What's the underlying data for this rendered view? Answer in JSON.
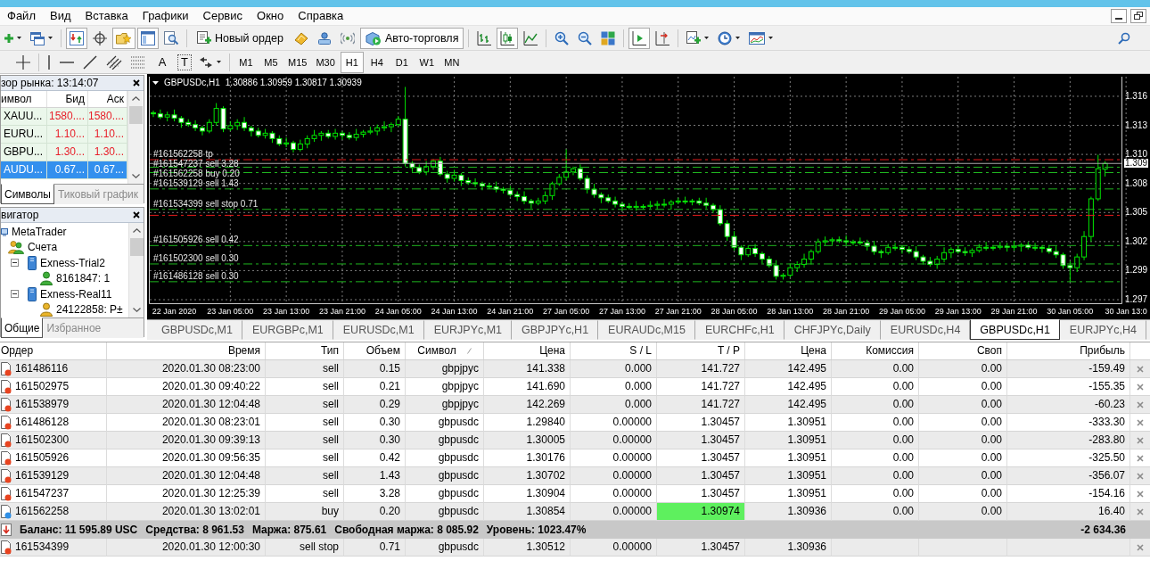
{
  "menu": {
    "items": [
      "Файл",
      "Вид",
      "Вставка",
      "Графики",
      "Сервис",
      "Окно",
      "Справка"
    ]
  },
  "toolbar": {
    "new_order": "Новый ордер",
    "autotrading": {
      "label": "Авто-торговля",
      "pressed": true
    },
    "pressed": {
      "market_watch": true,
      "data_window": false,
      "navigator": true,
      "terminal": true,
      "tester": false,
      "bar_chart": false,
      "candle_chart": true,
      "line_chart": false,
      "autoscroll": true,
      "chart_shift": false
    }
  },
  "drawing_toolbar": {
    "text_tool": "A",
    "label_tool": "T",
    "timeframes": [
      {
        "label": "M1",
        "selected": false
      },
      {
        "label": "M5",
        "selected": false
      },
      {
        "label": "M15",
        "selected": false
      },
      {
        "label": "M30",
        "selected": false
      },
      {
        "label": "H1",
        "selected": true
      },
      {
        "label": "H4",
        "selected": false
      },
      {
        "label": "D1",
        "selected": false
      },
      {
        "label": "W1",
        "selected": false
      },
      {
        "label": "MN",
        "selected": false
      }
    ]
  },
  "market_watch": {
    "title": "зор рынка: 13:14:07",
    "columns": [
      "имвол",
      "Бид",
      "Аск"
    ],
    "rows": [
      {
        "symbol": "XAUU...",
        "bid": "1580....",
        "ask": "1580....",
        "falling": true,
        "selected": false
      },
      {
        "symbol": "EURU...",
        "bid": "1.10...",
        "ask": "1.10...",
        "falling": true,
        "selected": false
      },
      {
        "symbol": "GBPU...",
        "bid": "1.30...",
        "ask": "1.30...",
        "falling": true,
        "selected": false
      },
      {
        "symbol": "AUDU...",
        "bid": "0.67...",
        "ask": "0.67...",
        "selected": true
      }
    ],
    "tabs": [
      {
        "label": "Символы",
        "selected": true
      },
      {
        "label": "Тиковый график",
        "selected": false
      }
    ]
  },
  "navigator": {
    "title": "вигатор",
    "tree": [
      {
        "label": "MetaTrader",
        "kind": "terminal",
        "children": [
          {
            "label": "Счета",
            "kind": "accounts",
            "children": [
              {
                "label": "Exness-Trial2",
                "kind": "server",
                "expanded": true,
                "children": [
                  {
                    "label": "8161847: 1",
                    "kind": "demo"
                  }
                ]
              },
              {
                "label": "Exness-Real11",
                "kind": "server",
                "expanded": true,
                "children": [
                  {
                    "label": "24122858: P±",
                    "kind": "real"
                  }
                ]
              }
            ]
          }
        ]
      }
    ],
    "tabs": [
      {
        "label": "Общие",
        "selected": true
      },
      {
        "label": "Избранное",
        "selected": false
      }
    ]
  },
  "chart": {
    "ohlc_readout": "1.30886 1.30959 1.30817 1.30939",
    "chart_data": {
      "type": "candlestick",
      "title": "GBPUSDc,H1",
      "categories": [
        null,
        null,
        null,
        "22 Jan 2020",
        null,
        null,
        null,
        null,
        null,
        null,
        null,
        "23 Jan 05:00",
        null,
        null,
        null,
        null,
        null,
        null,
        null,
        "23 Jan 13:00",
        null,
        null,
        null,
        null,
        null,
        null,
        null,
        "23 Jan 21:00",
        null,
        null,
        null,
        null,
        null,
        null,
        null,
        "24 Jan 05:00",
        null,
        null,
        null,
        null,
        null,
        null,
        null,
        "24 Jan 13:00",
        null,
        null,
        null,
        null,
        null,
        null,
        null,
        "24 Jan 21:00",
        null,
        null,
        null,
        null,
        null,
        null,
        null,
        "27 Jan 05:00",
        null,
        null,
        null,
        null,
        null,
        null,
        null,
        "27 Jan 13:00",
        null,
        null,
        null,
        null,
        null,
        null,
        null,
        "27 Jan 21:00",
        null,
        null,
        null,
        null,
        null,
        null,
        null,
        "28 Jan 05:00",
        null,
        null,
        null,
        null,
        null,
        null,
        null,
        "28 Jan 13:00",
        null,
        null,
        null,
        null,
        null,
        null,
        null,
        "28 Jan 21:00",
        null,
        null,
        null,
        null,
        null,
        null,
        null,
        "29 Jan 05:00",
        null,
        null,
        null,
        null,
        null,
        null,
        null,
        "29 Jan 13:00",
        null,
        null,
        null,
        null,
        null,
        null,
        null,
        "29 Jan 21:00",
        null,
        null,
        null,
        null,
        null,
        null,
        null,
        "30 Jan 05:00",
        null,
        null,
        null,
        null,
        null,
        null,
        null,
        "30 Jan 13:0"
      ],
      "ohlc": [
        [
          1.3141,
          1.3143,
          1.3137,
          1.314
        ],
        [
          1.314,
          1.3144,
          1.3135,
          1.3137
        ],
        [
          1.3137,
          1.3142,
          1.3133,
          1.3139
        ],
        [
          1.3139,
          1.3144,
          1.3133,
          1.3136
        ],
        [
          1.3136,
          1.3138,
          1.3127,
          1.3132
        ],
        [
          1.3132,
          1.3135,
          1.3128,
          1.313
        ],
        [
          1.313,
          1.3134,
          1.3124,
          1.3127
        ],
        [
          1.3127,
          1.3129,
          1.312,
          1.3124
        ],
        [
          1.3124,
          1.3135,
          1.3122,
          1.3132
        ],
        [
          1.3132,
          1.315,
          1.3129,
          1.3145
        ],
        [
          1.3145,
          1.3147,
          1.3123,
          1.3126
        ],
        [
          1.3126,
          1.3133,
          1.3124,
          1.3129
        ],
        [
          1.3129,
          1.3135,
          1.3125,
          1.3132
        ],
        [
          1.3132,
          1.3137,
          1.3124,
          1.3127
        ],
        [
          1.3127,
          1.3129,
          1.3119,
          1.3124
        ],
        [
          1.3124,
          1.3127,
          1.3118,
          1.312
        ],
        [
          1.312,
          1.3126,
          1.3117,
          1.3122
        ],
        [
          1.3122,
          1.3124,
          1.3113,
          1.3117
        ],
        [
          1.3117,
          1.312,
          1.311,
          1.3112
        ],
        [
          1.3112,
          1.3118,
          1.3109,
          1.3113
        ],
        [
          1.3113,
          1.3115,
          1.3104,
          1.3107
        ],
        [
          1.3107,
          1.3116,
          1.3105,
          1.3112
        ],
        [
          1.3112,
          1.312,
          1.3108,
          1.3117
        ],
        [
          1.3117,
          1.3125,
          1.3114,
          1.312
        ],
        [
          1.312,
          1.3124,
          1.3115,
          1.3122
        ],
        [
          1.3122,
          1.3125,
          1.3117,
          1.3119
        ],
        [
          1.3119,
          1.3126,
          1.3116,
          1.3122
        ],
        [
          1.3122,
          1.3124,
          1.3116,
          1.312
        ],
        [
          1.312,
          1.3123,
          1.3116,
          1.3118
        ],
        [
          1.3118,
          1.3126,
          1.3115,
          1.3121
        ],
        [
          1.3121,
          1.3125,
          1.3118,
          1.3123
        ],
        [
          1.3123,
          1.3128,
          1.3121,
          1.3124
        ],
        [
          1.3124,
          1.313,
          1.312,
          1.3127
        ],
        [
          1.3127,
          1.3133,
          1.3124,
          1.3128
        ],
        [
          1.3128,
          1.3132,
          1.3123,
          1.313
        ],
        [
          1.313,
          1.3138,
          1.3128,
          1.3135
        ],
        [
          1.3135,
          1.3165,
          1.3091,
          1.3094
        ],
        [
          1.3094,
          1.3096,
          1.3086,
          1.309
        ],
        [
          1.309,
          1.3093,
          1.3084,
          1.3086
        ],
        [
          1.3086,
          1.3096,
          1.3083,
          1.3091
        ],
        [
          1.3091,
          1.3098,
          1.3088,
          1.3096
        ],
        [
          1.3096,
          1.31,
          1.3082,
          1.3084
        ],
        [
          1.3084,
          1.3087,
          1.3076,
          1.308
        ],
        [
          1.308,
          1.3088,
          1.3077,
          1.3083
        ],
        [
          1.3083,
          1.3085,
          1.3073,
          1.3078
        ],
        [
          1.3078,
          1.3081,
          1.3074,
          1.3076
        ],
        [
          1.3076,
          1.308,
          1.3072,
          1.3075
        ],
        [
          1.3075,
          1.3077,
          1.3069,
          1.3073
        ],
        [
          1.3073,
          1.3076,
          1.307,
          1.3072
        ],
        [
          1.3072,
          1.3077,
          1.3067,
          1.307
        ],
        [
          1.307,
          1.3072,
          1.3066,
          1.3069
        ],
        [
          1.3069,
          1.3073,
          1.3063,
          1.3065
        ],
        [
          1.3065,
          1.3068,
          1.3059,
          1.3063
        ],
        [
          1.3063,
          1.3068,
          1.3056,
          1.3059
        ],
        [
          1.3059,
          1.3061,
          1.3052,
          1.3057
        ],
        [
          1.3057,
          1.3062,
          1.3055,
          1.3059
        ],
        [
          1.3059,
          1.3068,
          1.3056,
          1.3064
        ],
        [
          1.3064,
          1.3077,
          1.306,
          1.3075
        ],
        [
          1.3075,
          1.3084,
          1.3073,
          1.3081
        ],
        [
          1.3081,
          1.3107,
          1.3078,
          1.3086
        ],
        [
          1.3086,
          1.3091,
          1.3083,
          1.3089
        ],
        [
          1.3089,
          1.3093,
          1.3078,
          1.308
        ],
        [
          1.308,
          1.3083,
          1.3066,
          1.307
        ],
        [
          1.307,
          1.3075,
          1.3062,
          1.3065
        ],
        [
          1.3065,
          1.3067,
          1.3057,
          1.3062
        ],
        [
          1.3062,
          1.3065,
          1.3057,
          1.3059
        ],
        [
          1.3059,
          1.3063,
          1.3053,
          1.3056
        ],
        [
          1.3056,
          1.3058,
          1.305,
          1.3054
        ],
        [
          1.3054,
          1.3057,
          1.3051,
          1.3053
        ],
        [
          1.3053,
          1.3059,
          1.305,
          1.3054
        ],
        [
          1.3054,
          1.3056,
          1.3051,
          1.3054
        ],
        [
          1.3054,
          1.3059,
          1.3052,
          1.3055
        ],
        [
          1.3055,
          1.3059,
          1.3051,
          1.3056
        ],
        [
          1.3056,
          1.3061,
          1.3053,
          1.3056
        ],
        [
          1.3056,
          1.306,
          1.3051,
          1.3058
        ],
        [
          1.3058,
          1.3062,
          1.3056,
          1.3059
        ],
        [
          1.3059,
          1.3063,
          1.3056,
          1.3059
        ],
        [
          1.3059,
          1.3061,
          1.3055,
          1.3059
        ],
        [
          1.3059,
          1.3062,
          1.3055,
          1.3057
        ],
        [
          1.3057,
          1.3062,
          1.3052,
          1.3055
        ],
        [
          1.3055,
          1.3057,
          1.3048,
          1.3051
        ],
        [
          1.3051,
          1.3055,
          1.3036,
          1.3038
        ],
        [
          1.3038,
          1.3041,
          1.3022,
          1.3026
        ],
        [
          1.3026,
          1.3031,
          1.3013,
          1.3016
        ],
        [
          1.3016,
          1.3018,
          1.3004,
          1.3009
        ],
        [
          1.3009,
          1.3018,
          1.3007,
          1.3015
        ],
        [
          1.3015,
          1.3019,
          1.3007,
          1.301
        ],
        [
          1.301,
          1.3012,
          1.3001,
          1.3005
        ],
        [
          1.3005,
          1.3008,
          1.2997,
          1.2999
        ],
        [
          1.2999,
          1.3004,
          1.2986,
          1.2989
        ],
        [
          1.2989,
          1.2992,
          1.2986,
          1.299
        ],
        [
          1.299,
          1.3001,
          1.2988,
          1.2997
        ],
        [
          1.2997,
          1.3003,
          1.2993,
          1.3
        ],
        [
          1.3,
          1.301,
          1.2997,
          1.3005
        ],
        [
          1.3005,
          1.3014,
          1.3,
          1.3012
        ],
        [
          1.3012,
          1.3024,
          1.301,
          1.3021
        ],
        [
          1.3021,
          1.3026,
          1.3018,
          1.3022
        ],
        [
          1.3022,
          1.3025,
          1.3018,
          1.3023
        ],
        [
          1.3023,
          1.3026,
          1.302,
          1.3022
        ],
        [
          1.3022,
          1.3027,
          1.3018,
          1.3021
        ],
        [
          1.3021,
          1.3023,
          1.3018,
          1.3021
        ],
        [
          1.3021,
          1.3025,
          1.3018,
          1.302
        ],
        [
          1.302,
          1.3023,
          1.3013,
          1.3017
        ],
        [
          1.3017,
          1.3022,
          1.3009,
          1.3012
        ],
        [
          1.3012,
          1.3014,
          1.3006,
          1.3011
        ],
        [
          1.3011,
          1.3019,
          1.3009,
          1.3016
        ],
        [
          1.3016,
          1.302,
          1.3013,
          1.3016
        ],
        [
          1.3016,
          1.3018,
          1.301,
          1.3014
        ],
        [
          1.3014,
          1.3017,
          1.301,
          1.3012
        ],
        [
          1.3012,
          1.3017,
          1.3004,
          1.3007
        ],
        [
          1.3007,
          1.3009,
          1.3,
          1.3003
        ],
        [
          1.3003,
          1.3007,
          1.2998,
          1.3
        ],
        [
          1.3,
          1.3008,
          1.2996,
          1.3005
        ],
        [
          1.3005,
          1.3016,
          1.3002,
          1.3011
        ],
        [
          1.3011,
          1.3016,
          1.3006,
          1.3014
        ],
        [
          1.3014,
          1.3017,
          1.301,
          1.3012
        ],
        [
          1.3012,
          1.3016,
          1.3008,
          1.3011
        ],
        [
          1.3011,
          1.3015,
          1.3007,
          1.3013
        ],
        [
          1.3013,
          1.3019,
          1.3011,
          1.3016
        ],
        [
          1.3016,
          1.3021,
          1.3013,
          1.3016
        ],
        [
          1.3016,
          1.3018,
          1.3013,
          1.3016
        ],
        [
          1.3016,
          1.3021,
          1.3014,
          1.3017
        ],
        [
          1.3017,
          1.302,
          1.3012,
          1.3016
        ],
        [
          1.3016,
          1.3022,
          1.3013,
          1.3017
        ],
        [
          1.3017,
          1.302,
          1.3012,
          1.3018
        ],
        [
          1.3018,
          1.3021,
          1.3014,
          1.3016
        ],
        [
          1.3016,
          1.302,
          1.3013,
          1.3016
        ],
        [
          1.3016,
          1.3018,
          1.3011,
          1.3015
        ],
        [
          1.3015,
          1.3018,
          1.301,
          1.3012
        ],
        [
          1.3012,
          1.3017,
          1.3006,
          1.3009
        ],
        [
          1.3009,
          1.3011,
          1.2996,
          1.2999
        ],
        [
          1.2999,
          1.3003,
          1.2984,
          1.2997
        ],
        [
          1.2997,
          1.301,
          1.2993,
          1.3007
        ],
        [
          1.3007,
          1.3031,
          1.3004,
          1.3026
        ],
        [
          1.3026,
          1.3063,
          1.3021,
          1.3061
        ],
        [
          1.3061,
          1.3102,
          1.3059,
          1.3089
        ],
        [
          1.30886,
          1.30959,
          1.30817,
          1.30939
        ],
        null,
        null,
        null
      ],
      "ylim": [
        1.2964,
        1.31745
      ],
      "yticks": [
        {
          "value": 1.31563,
          "label": "1.316"
        },
        {
          "value": 1.31293,
          "label": "1.313"
        },
        {
          "value": 1.31023,
          "label": "1.310"
        },
        {
          "value": 1.30753,
          "label": "1.308"
        },
        {
          "value": 1.30483,
          "label": "1.305"
        },
        {
          "value": 1.30213,
          "label": "1.302"
        },
        {
          "value": 1.29943,
          "label": "1.299"
        },
        {
          "value": 1.29673,
          "label": "1.297"
        }
      ],
      "grid": true,
      "ref_lines": [
        {
          "axis": "y",
          "value": 1.30974,
          "label": "#161562258 tp",
          "color": "#e31b1b"
        },
        {
          "axis": "y",
          "value": 1.30939,
          "label": "1.309",
          "color": "#a8a8a8"
        },
        {
          "axis": "y",
          "value": 1.30904,
          "label": "#161547237 sell 3.28",
          "color": "#1fb51f"
        },
        {
          "axis": "y",
          "value": 1.30854,
          "label": "#161562258 buy 0.20",
          "color": "#1fb51f"
        },
        {
          "axis": "y",
          "value": 1.30702,
          "label": "#161539129 sell 1.43",
          "color": "#1fb51f"
        },
        {
          "axis": "y",
          "value": 1.30512,
          "label": "#161534399 sell stop 0.71",
          "color": "#1fb51f"
        },
        {
          "axis": "y",
          "value": 1.30457,
          "color": "#e31b1b"
        },
        {
          "axis": "y",
          "value": 1.30176,
          "label": "#161505926 sell 0.42",
          "color": "#1fb51f"
        },
        {
          "axis": "y",
          "value": 1.30005,
          "label": "#161502300 sell 0.30",
          "color": "#1fb51f"
        },
        {
          "axis": "y",
          "value": 1.2984,
          "label": "#161486128 sell 0.30",
          "color": "#1fb51f"
        }
      ]
    }
  },
  "chart_tabs": [
    {
      "label": "GBPUSDc,M1",
      "selected": false
    },
    {
      "label": "EURGBPc,M1",
      "selected": false
    },
    {
      "label": "EURUSDc,M1",
      "selected": false
    },
    {
      "label": "EURJPYc,M1",
      "selected": false
    },
    {
      "label": "GBPJPYc,H1",
      "selected": false
    },
    {
      "label": "EURAUDc,M15",
      "selected": false
    },
    {
      "label": "EURCHFc,H1",
      "selected": false
    },
    {
      "label": "CHFJPYc,Daily",
      "selected": false
    },
    {
      "label": "EURUSDc,H4",
      "selected": false
    },
    {
      "label": "GBPUSDc,H1",
      "selected": true
    },
    {
      "label": "EURJPYc,H4",
      "selected": false
    }
  ],
  "terminal": {
    "columns": [
      {
        "label": "Ордер",
        "sorted": false
      },
      {
        "label": "Время",
        "sorted": false
      },
      {
        "label": "Тип",
        "sorted": false
      },
      {
        "label": "Объем",
        "sorted": false
      },
      {
        "label": "Символ",
        "sorted": true
      },
      {
        "label": "Цена",
        "sorted": false
      },
      {
        "label": "S / L",
        "sorted": false
      },
      {
        "label": "T / P",
        "sorted": false
      },
      {
        "label": "Цена",
        "sorted": false
      },
      {
        "label": "Комиссия",
        "sorted": false
      },
      {
        "label": "Своп",
        "sorted": false
      },
      {
        "label": "Прибыль",
        "sorted": false
      }
    ],
    "rows": [
      {
        "order": "161486116",
        "time": "2020.01.30 08:23:00",
        "type": "sell",
        "volume": "0.15",
        "symbol": "gbpjpyc",
        "price": "141.338",
        "sl": "0.000",
        "tp": "141.727",
        "current_price": "142.495",
        "commission": "0.00",
        "swap": "0.00",
        "profit": "-159.49",
        "color": "#e8431f",
        "tp_highlighted": false
      },
      {
        "order": "161502975",
        "time": "2020.01.30 09:40:22",
        "type": "sell",
        "volume": "0.21",
        "symbol": "gbpjpyc",
        "price": "141.690",
        "sl": "0.000",
        "tp": "141.727",
        "current_price": "142.495",
        "commission": "0.00",
        "swap": "0.00",
        "profit": "-155.35",
        "color": "#e8431f",
        "tp_highlighted": false
      },
      {
        "order": "161538979",
        "time": "2020.01.30 12:04:48",
        "type": "sell",
        "volume": "0.29",
        "symbol": "gbpjpyc",
        "price": "142.269",
        "sl": "0.000",
        "tp": "141.727",
        "current_price": "142.495",
        "commission": "0.00",
        "swap": "0.00",
        "profit": "-60.23",
        "color": "#e8431f",
        "tp_highlighted": false
      },
      {
        "order": "161486128",
        "time": "2020.01.30 08:23:01",
        "type": "sell",
        "volume": "0.30",
        "symbol": "gbpusdc",
        "price": "1.29840",
        "sl": "0.00000",
        "tp": "1.30457",
        "current_price": "1.30951",
        "commission": "0.00",
        "swap": "0.00",
        "profit": "-333.30",
        "color": "#e8431f",
        "tp_highlighted": false
      },
      {
        "order": "161502300",
        "time": "2020.01.30 09:39:13",
        "type": "sell",
        "volume": "0.30",
        "symbol": "gbpusdc",
        "price": "1.30005",
        "sl": "0.00000",
        "tp": "1.30457",
        "current_price": "1.30951",
        "commission": "0.00",
        "swap": "0.00",
        "profit": "-283.80",
        "color": "#e8431f",
        "tp_highlighted": false
      },
      {
        "order": "161505926",
        "time": "2020.01.30 09:56:35",
        "type": "sell",
        "volume": "0.42",
        "symbol": "gbpusdc",
        "price": "1.30176",
        "sl": "0.00000",
        "tp": "1.30457",
        "current_price": "1.30951",
        "commission": "0.00",
        "swap": "0.00",
        "profit": "-325.50",
        "color": "#e8431f",
        "tp_highlighted": false
      },
      {
        "order": "161539129",
        "time": "2020.01.30 12:04:48",
        "type": "sell",
        "volume": "1.43",
        "symbol": "gbpusdc",
        "price": "1.30702",
        "sl": "0.00000",
        "tp": "1.30457",
        "current_price": "1.30951",
        "commission": "0.00",
        "swap": "0.00",
        "profit": "-356.07",
        "color": "#e8431f",
        "tp_highlighted": false
      },
      {
        "order": "161547237",
        "time": "2020.01.30 12:25:39",
        "type": "sell",
        "volume": "3.28",
        "symbol": "gbpusdc",
        "price": "1.30904",
        "sl": "0.00000",
        "tp": "1.30457",
        "current_price": "1.30951",
        "commission": "0.00",
        "swap": "0.00",
        "profit": "-154.16",
        "color": "#e8431f",
        "tp_highlighted": false
      },
      {
        "order": "161562258",
        "time": "2020.01.30 13:02:01",
        "type": "buy",
        "volume": "0.20",
        "symbol": "gbpusdc",
        "price": "1.30854",
        "sl": "0.00000",
        "tp": "1.30974",
        "current_price": "1.30936",
        "commission": "0.00",
        "swap": "0.00",
        "profit": "16.40",
        "color": "#2f8fe6",
        "tp_highlighted": true
      }
    ],
    "summary": {
      "items": [
        "Баланс: 11 595.89 USC",
        "Средства: 8 961.53",
        "Маржа: 875.61",
        "Свободная маржа: 8 085.92",
        "Уровень: 1023.47%"
      ],
      "total": "-2 634.36"
    },
    "pending": [
      {
        "order": "161534399",
        "time": "2020.01.30 12:00:30",
        "type": "sell stop",
        "volume": "0.71",
        "symbol": "gbpusdc",
        "price": "1.30512",
        "sl": "0.00000",
        "tp": "1.30457",
        "current_price": "1.30936",
        "color": "#e8431f",
        "tp_highlighted": false
      }
    ]
  }
}
